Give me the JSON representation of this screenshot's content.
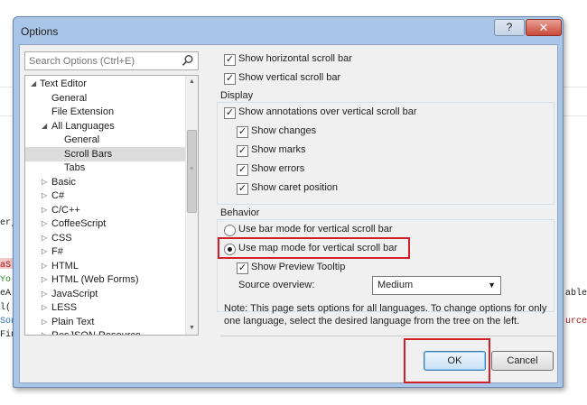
{
  "background_editor": {
    "fragments": [
      {
        "text": "er,",
        "color": "#1e1e1e"
      },
      {
        "text": "aS",
        "color": "#a31515"
      },
      {
        "text": "Yo",
        "color": "#2b8a2b"
      },
      {
        "text": "eA",
        "color": "#1e1e1e"
      },
      {
        "text": "l(",
        "color": "#1e1e1e"
      },
      {
        "text": "Sou",
        "color": "#2b6fc1"
      },
      {
        "text": "Fin",
        "color": "#1e1e1e"
      }
    ],
    "right_fragments": [
      {
        "text": "able",
        "color": "#1e1e1e"
      },
      {
        "text": "urce",
        "color": "#a31515"
      }
    ]
  },
  "dialog": {
    "title": "Options",
    "help_label": "?",
    "close_label": "✕",
    "search": {
      "placeholder": "Search Options (Ctrl+E)",
      "value": ""
    },
    "tree": [
      {
        "label": "Text Editor",
        "expanded": true
      },
      {
        "label": "General"
      },
      {
        "label": "File Extension"
      },
      {
        "label": "All Languages",
        "expanded": true
      },
      {
        "label": "General"
      },
      {
        "label": "Scroll Bars",
        "selected": true
      },
      {
        "label": "Tabs"
      },
      {
        "label": "Basic",
        "expanded": false
      },
      {
        "label": "C#",
        "expanded": false
      },
      {
        "label": "C/C++",
        "expanded": false
      },
      {
        "label": "CoffeeScript",
        "expanded": false
      },
      {
        "label": "CSS",
        "expanded": false
      },
      {
        "label": "F#",
        "expanded": false
      },
      {
        "label": "HTML",
        "expanded": false
      },
      {
        "label": "HTML (Web Forms)",
        "expanded": false
      },
      {
        "label": "JavaScript",
        "expanded": false
      },
      {
        "label": "LESS",
        "expanded": false
      },
      {
        "label": "Plain Text",
        "expanded": false
      },
      {
        "label": "ResJSON Resource",
        "expanded": false
      }
    ],
    "options": {
      "show_horizontal": {
        "label": "Show horizontal scroll bar",
        "checked": true
      },
      "show_vertical": {
        "label": "Show vertical scroll bar",
        "checked": true
      },
      "display_group": "Display",
      "show_annotations": {
        "label": "Show annotations over vertical scroll bar",
        "checked": true
      },
      "show_changes": {
        "label": "Show changes",
        "checked": true
      },
      "show_marks": {
        "label": "Show marks",
        "checked": true
      },
      "show_errors": {
        "label": "Show errors",
        "checked": true
      },
      "show_caret": {
        "label": "Show caret position",
        "checked": true
      },
      "behavior_group": "Behavior",
      "bar_mode": {
        "label": "Use bar mode for vertical scroll bar",
        "selected": false
      },
      "map_mode": {
        "label": "Use map mode for vertical scroll bar",
        "selected": true
      },
      "show_preview": {
        "label": "Show Preview Tooltip",
        "checked": true
      },
      "source_overview": {
        "label": "Source overview:",
        "value": "Medium"
      }
    },
    "note": "Note: This page sets options for all languages. To change options for only one language, select the desired language from the tree on the left.",
    "buttons": {
      "ok": "OK",
      "cancel": "Cancel"
    },
    "colors": {
      "highlight": "#d21f2a",
      "title_bar": "#a9c6e8",
      "selected_row": "#dcdcdc"
    }
  }
}
